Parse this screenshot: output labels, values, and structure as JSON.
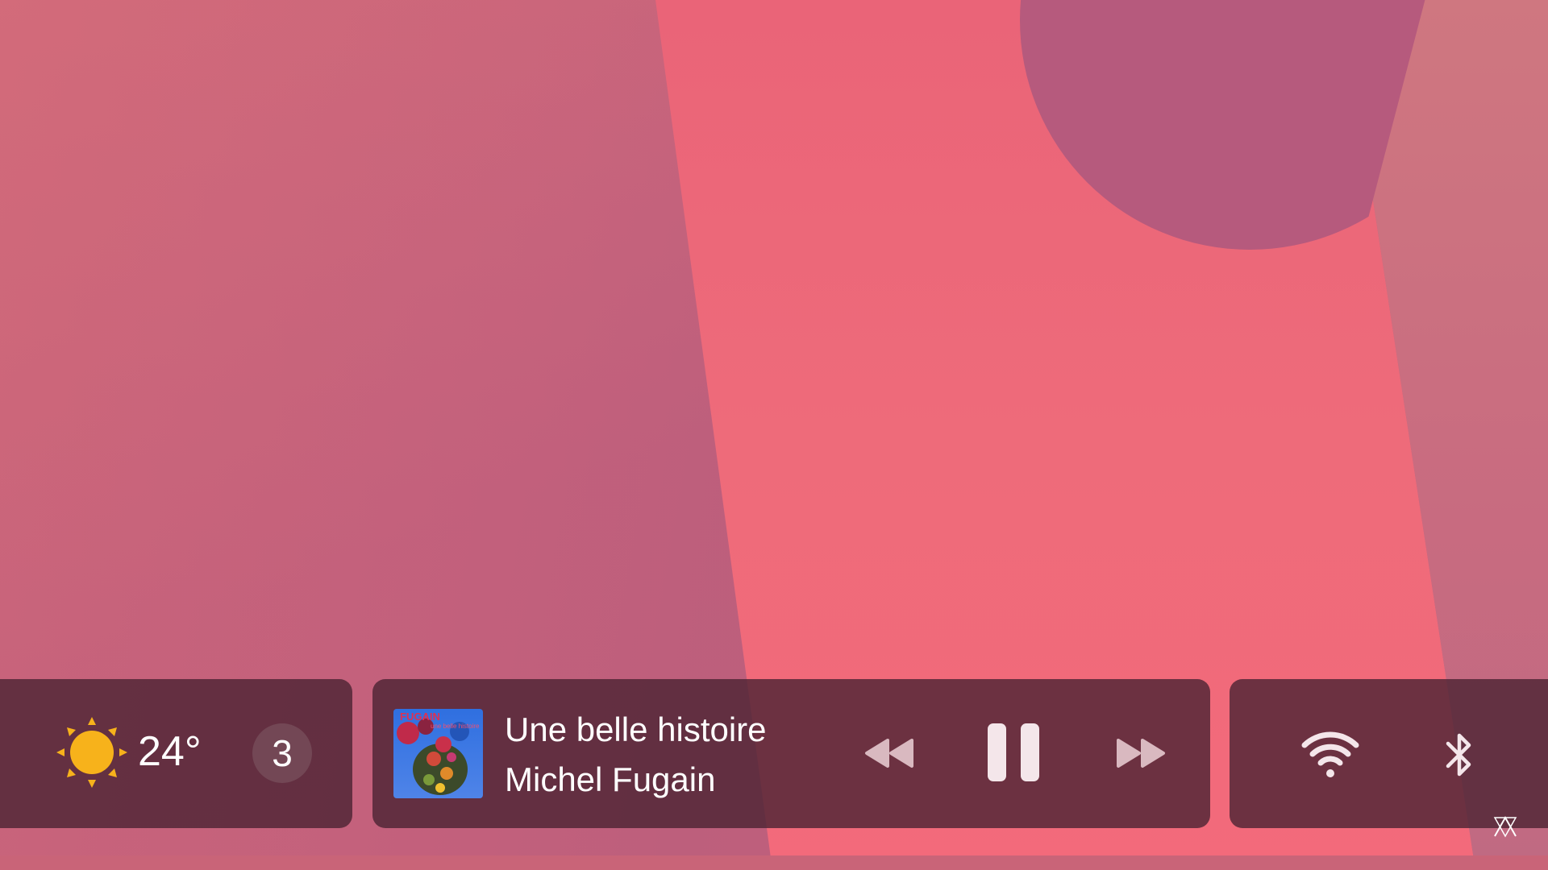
{
  "weather": {
    "icon": "sun-icon",
    "temperature": "24°",
    "badge_count": "3"
  },
  "media": {
    "album_art": "album-cover",
    "title": "Une belle histoire",
    "artist": "Michel Fugain",
    "controls": {
      "previous_icon": "rewind-icon",
      "play_state_icon": "pause-icon",
      "next_icon": "fast-forward-icon"
    }
  },
  "connectivity": {
    "wifi_icon": "wifi-icon",
    "bluetooth_icon": "bluetooth-icon"
  },
  "colors": {
    "panel_bg": "#4e2434",
    "sun": "#f7b21b",
    "wallpaper_band": "#ee6b7a",
    "wallpaper_circle": "#b65a7d"
  }
}
